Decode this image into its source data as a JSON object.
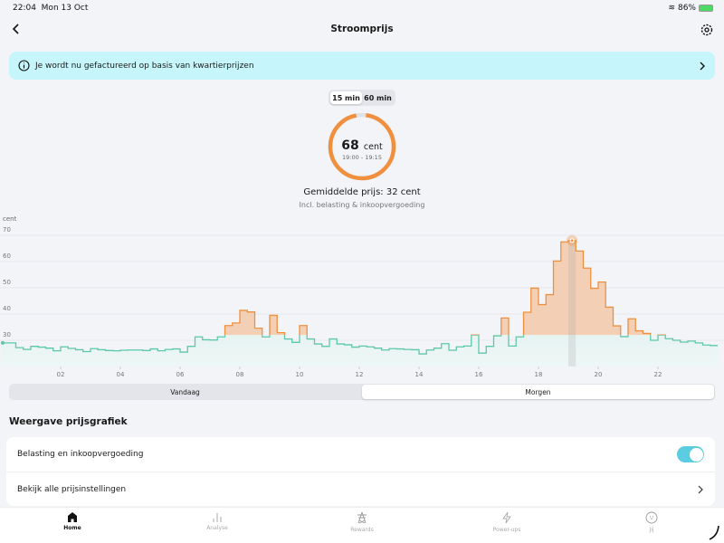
{
  "status": {
    "time": "22:04",
    "date": "Mon 13 Oct",
    "battery": "86%",
    "icons": [
      "wifi-icon",
      "battery-charging-icon"
    ]
  },
  "nav": {
    "title": "Stroomprijs",
    "back_icon": "chevron-left-icon",
    "settings_icon": "gear-icon"
  },
  "banner": {
    "text": "Je wordt nu gefactureerd op basis van kwartierprijzen",
    "icon": "info-icon"
  },
  "interval": {
    "options": [
      "15 min",
      "60 min"
    ],
    "selected": "15 min"
  },
  "current": {
    "value": "68",
    "unit": "cent",
    "time": "19:00 - 19:15"
  },
  "average": "Gemiddelde prijs: 32 cent",
  "incl": "Incl. belasting & inkoopvergoeding",
  "day_tabs": {
    "options": [
      "Vandaag",
      "Morgen"
    ],
    "selected": "Morgen"
  },
  "section_title": "Weergave prijsgrafiek",
  "settings": {
    "toggle_label": "Belasting en inkoopvergoeding",
    "toggle_on": true,
    "link_label": "Bekijk alle prijsinstellingen"
  },
  "tabbar": [
    {
      "label": "Home",
      "icon": "home-icon",
      "active": true
    },
    {
      "label": "Analyse",
      "icon": "bar-chart-icon"
    },
    {
      "label": "Rewards",
      "icon": "pylon-icon"
    },
    {
      "label": "Power-ups",
      "icon": "lightning-icon"
    },
    {
      "label": "Jij",
      "icon": "face-icon"
    }
  ],
  "colors": {
    "above": "#f0903f",
    "below": "#5cc8a8",
    "accent": "#5ccde0",
    "banner": "#c6f6fb"
  },
  "chart_data": {
    "type": "line",
    "step": true,
    "ylabel": "cent",
    "ylim": [
      20,
      70
    ],
    "yticks": [
      "20",
      "30",
      "40",
      "50",
      "60",
      "70"
    ],
    "xticks": [
      "02",
      "04",
      "06",
      "08",
      "10",
      "12",
      "14",
      "16",
      "18",
      "20",
      "22"
    ],
    "xlim_hours": [
      0,
      24
    ],
    "interval_minutes": 15,
    "threshold": 32,
    "selected_index": 76,
    "grid": true,
    "values": [
      29,
      29,
      27.2,
      26.5,
      27.7,
      27.4,
      27,
      26,
      27.5,
      26.9,
      26.4,
      25.7,
      26.8,
      26.4,
      26.1,
      26,
      26.2,
      26.3,
      26.3,
      26.1,
      26.7,
      26,
      26.5,
      26.7,
      25.5,
      27.7,
      31.3,
      30.2,
      30.1,
      31.3,
      35.6,
      36.6,
      41.4,
      40.8,
      34.6,
      31.3,
      39.5,
      32.9,
      30.5,
      29.2,
      35.6,
      30.5,
      28.6,
      27.7,
      30.5,
      28.6,
      28.3,
      27.4,
      27.8,
      27.5,
      27,
      26.3,
      26.8,
      26.7,
      26.5,
      26.4,
      24.8,
      26.3,
      27,
      28.7,
      26.2,
      27.5,
      27.8,
      32,
      25.1,
      27.7,
      31.7,
      38.5,
      27.8,
      31.3,
      40.7,
      49.9,
      43.6,
      47.4,
      60.2,
      67.5,
      68,
      64,
      57.5,
      49.8,
      52.2,
      42.6,
      35.5,
      31.4,
      38.2,
      33.6,
      32.6,
      30,
      32,
      30.6,
      30,
      29.3,
      29.7,
      29,
      28.2,
      28
    ]
  }
}
